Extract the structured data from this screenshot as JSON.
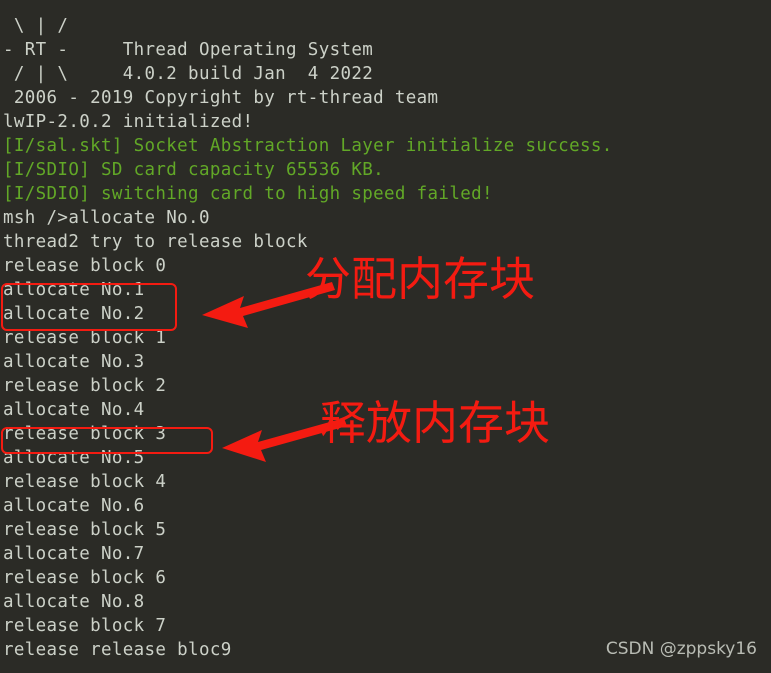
{
  "terminal": {
    "background_color": "#2b2b26",
    "default_text_color": "#ccd1c8",
    "log_text_color": "#62a827",
    "annotation_color": "#f41b11",
    "lines": [
      {
        "text": " \\ | /",
        "color": "default"
      },
      {
        "text": "- RT -     Thread Operating System",
        "color": "default"
      },
      {
        "text": " / | \\     4.0.2 build Jan  4 2022",
        "color": "default"
      },
      {
        "text": " 2006 - 2019 Copyright by rt-thread team",
        "color": "default"
      },
      {
        "text": "lwIP-2.0.2 initialized!",
        "color": "default"
      },
      {
        "text": "[I/sal.skt] Socket Abstraction Layer initialize success.",
        "color": "green"
      },
      {
        "text": "[I/SDIO] SD card capacity 65536 KB.",
        "color": "green"
      },
      {
        "text": "[I/SDIO] switching card to high speed failed!",
        "color": "green"
      },
      {
        "text": "msh />allocate No.0",
        "color": "default"
      },
      {
        "text": "thread2 try to release block",
        "color": "default"
      },
      {
        "text": "release block 0",
        "color": "default"
      },
      {
        "text": "allocate No.1",
        "color": "default"
      },
      {
        "text": "allocate No.2",
        "color": "default"
      },
      {
        "text": "release block 1",
        "color": "default"
      },
      {
        "text": "allocate No.3",
        "color": "default"
      },
      {
        "text": "release block 2",
        "color": "default"
      },
      {
        "text": "allocate No.4",
        "color": "default"
      },
      {
        "text": "release block 3",
        "color": "default"
      },
      {
        "text": "allocate No.5",
        "color": "default"
      },
      {
        "text": "release block 4",
        "color": "default"
      },
      {
        "text": "allocate No.6",
        "color": "default"
      },
      {
        "text": "release block 5",
        "color": "default"
      },
      {
        "text": "allocate No.7",
        "color": "default"
      },
      {
        "text": "release block 6",
        "color": "default"
      },
      {
        "text": "allocate No.8",
        "color": "default"
      },
      {
        "text": "release block 7",
        "color": "default"
      },
      {
        "text": "release release bloc9",
        "color": "default"
      }
    ]
  },
  "annotations": [
    {
      "id": "allocate-annotation",
      "label": "分配内存块",
      "highlight_lines": [
        "allocate No.1",
        "allocate No.2"
      ]
    },
    {
      "id": "release-annotation",
      "label": "释放内存块",
      "highlight_lines": [
        "release block 3"
      ]
    }
  ],
  "watermark": {
    "text": "CSDN @zppsky16"
  }
}
